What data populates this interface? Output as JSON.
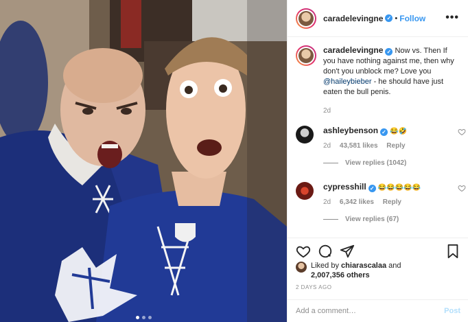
{
  "post": {
    "author": "caradelevingne",
    "follow_label": "Follow",
    "separator": "•",
    "more_label": "•••",
    "caption_intro": "Now vs. Then",
    "caption_line2": "If you have nothing against me, then why don't you unblock me? Love you",
    "mention": "@haileybieber",
    "caption_end": "- he should have just eaten the bull penis.",
    "caption_time": "2d"
  },
  "comments": [
    {
      "username": "ashleybenson",
      "text": "😂🤣",
      "time": "2d",
      "likes": "43,581 likes",
      "reply_label": "Reply",
      "view_replies": "View replies (1042)"
    },
    {
      "username": "cypresshill",
      "text": "😂😂😂😂😂",
      "time": "2d",
      "likes": "6,342 likes",
      "reply_label": "Reply",
      "view_replies": "View replies (67)"
    }
  ],
  "likes": {
    "prefix": "Liked by",
    "user": "chiarascalaa",
    "middle": "and",
    "count": "2,007,356 others"
  },
  "timestamp": "2 DAYS AGO",
  "comment_box": {
    "placeholder": "Add a comment…",
    "post_label": "Post"
  },
  "colors": {
    "accent": "#3897f0",
    "verified": "#3897f0",
    "post_disabled": "#b2dffc",
    "muted": "#8e8e8e"
  },
  "icons": [
    "verified-badge-icon",
    "more-icon",
    "heart-icon",
    "comment-icon",
    "share-icon",
    "bookmark-icon"
  ],
  "carousel": {
    "slides": 3,
    "active": 1
  }
}
